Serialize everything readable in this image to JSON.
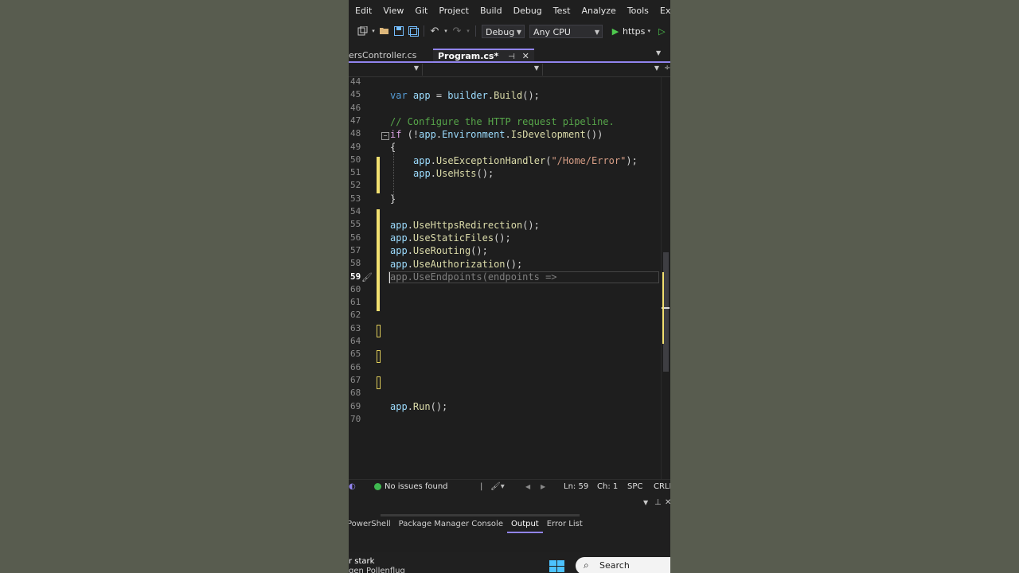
{
  "menu": [
    "Edit",
    "View",
    "Git",
    "Project",
    "Build",
    "Debug",
    "Test",
    "Analyze",
    "Tools",
    "Extensio"
  ],
  "toolbar": {
    "config": "Debug",
    "platform": "Any CPU",
    "run_target": "https"
  },
  "tabs": [
    {
      "label": "ersController.cs",
      "active": false
    },
    {
      "label": "Program.cs*",
      "active": true
    }
  ],
  "editor": {
    "line_numbers": [
      "44",
      "45",
      "46",
      "47",
      "48",
      "49",
      "50",
      "51",
      "52",
      "53",
      "54",
      "55",
      "56",
      "57",
      "58",
      "59",
      "60",
      "61",
      "62",
      "63",
      "64",
      "65",
      "66",
      "67",
      "68",
      "69",
      "70"
    ],
    "current_line": "59",
    "code": {
      "l45": {
        "k": "var",
        "id": "app",
        "eq": " = ",
        "obj": "builder",
        "fn": "Build",
        "end": "();"
      },
      "l47": "// Configure the HTTP request pipeline.",
      "l48": {
        "kw": "if",
        "p1": " (!",
        "obj": "app",
        "p2": ".",
        "prop": "Environment",
        "p3": ".",
        "fn": "IsDevelopment",
        "end": "())"
      },
      "l49": "{",
      "l50": {
        "obj": "app",
        "fn": "UseExceptionHandler",
        "open": "(",
        "str": "\"/Home/Error\"",
        "end": ");"
      },
      "l51": {
        "obj": "app",
        "fn": "UseHsts",
        "end": "();"
      },
      "l53": "}",
      "l55": {
        "obj": "app",
        "fn": "UseHttpsRedirection",
        "end": "();"
      },
      "l56": {
        "obj": "app",
        "fn": "UseStaticFiles",
        "end": "();"
      },
      "l57": {
        "obj": "app",
        "fn": "UseRouting",
        "end": "();"
      },
      "l58": {
        "obj": "app",
        "fn": "UseAuthorization",
        "end": "();"
      },
      "l59": "app.UseEndpoints(endpoints =>",
      "l69": {
        "obj": "app",
        "fn": "Run",
        "end": "();"
      }
    }
  },
  "status": {
    "issues": "No issues found",
    "line": "Ln: 59",
    "col": "Ch: 1",
    "spc": "SPC",
    "eol": "CRLF"
  },
  "bottom_tabs": [
    {
      "label": "PowerShell",
      "active": false
    },
    {
      "label": "Package Manager Console",
      "active": false
    },
    {
      "label": "Output",
      "active": true
    },
    {
      "label": "Error List",
      "active": false
    }
  ],
  "taskbar": {
    "notif_line1": "r stark",
    "notif_line2": "gen Pollenflug",
    "search": "Search"
  },
  "colors": {
    "accent": "#9184ee",
    "keyword": "#569cd6",
    "identifier": "#9cdcfe",
    "method": "#dcdcaa",
    "comment": "#57a64a",
    "string": "#d69d85",
    "change_marker": "#f2e070"
  }
}
